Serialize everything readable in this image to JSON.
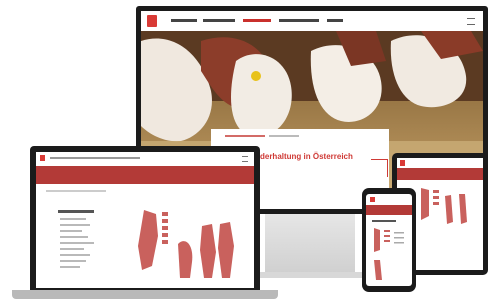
{
  "hero": {
    "headline": "Rinderhaltung in Österreich"
  },
  "desktop_nav": {
    "items": [
      "",
      "",
      "",
      "",
      ""
    ]
  },
  "colors": {
    "accent": "#b33a37",
    "device": "#1b1b1b"
  }
}
